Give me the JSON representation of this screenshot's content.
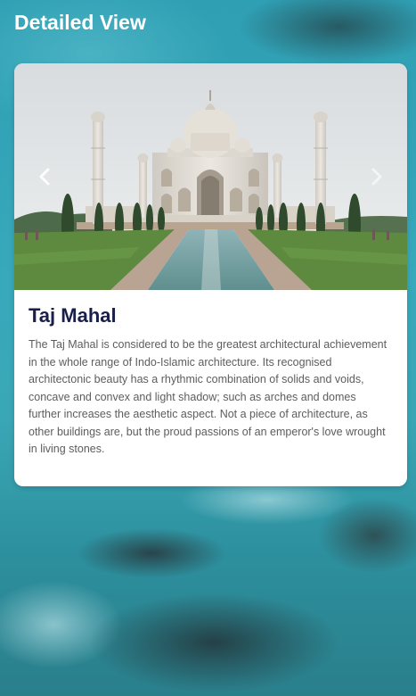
{
  "header": {
    "title": "Detailed View"
  },
  "carousel": {
    "prev_icon": "chevron-left-icon",
    "next_icon": "chevron-right-icon",
    "image_subject": "taj-mahal-photo"
  },
  "detail": {
    "title": "Taj Mahal",
    "description": "The Taj Mahal is considered to be the greatest architectural achievement in the whole range of Indo-Islamic architecture. Its recognised architectonic beauty has a rhythmic combination of solids and voids, concave and convex and light shadow; such as arches and domes further increases the aesthetic aspect. Not a piece of architecture, as other buildings are, but the proud passions of an emperor's love wrought in living stones."
  },
  "colors": {
    "title_color": "#1a1f4a",
    "text_color": "#5d5d5d",
    "card_bg": "#ffffff",
    "background_teal": "#2f9fb3"
  }
}
